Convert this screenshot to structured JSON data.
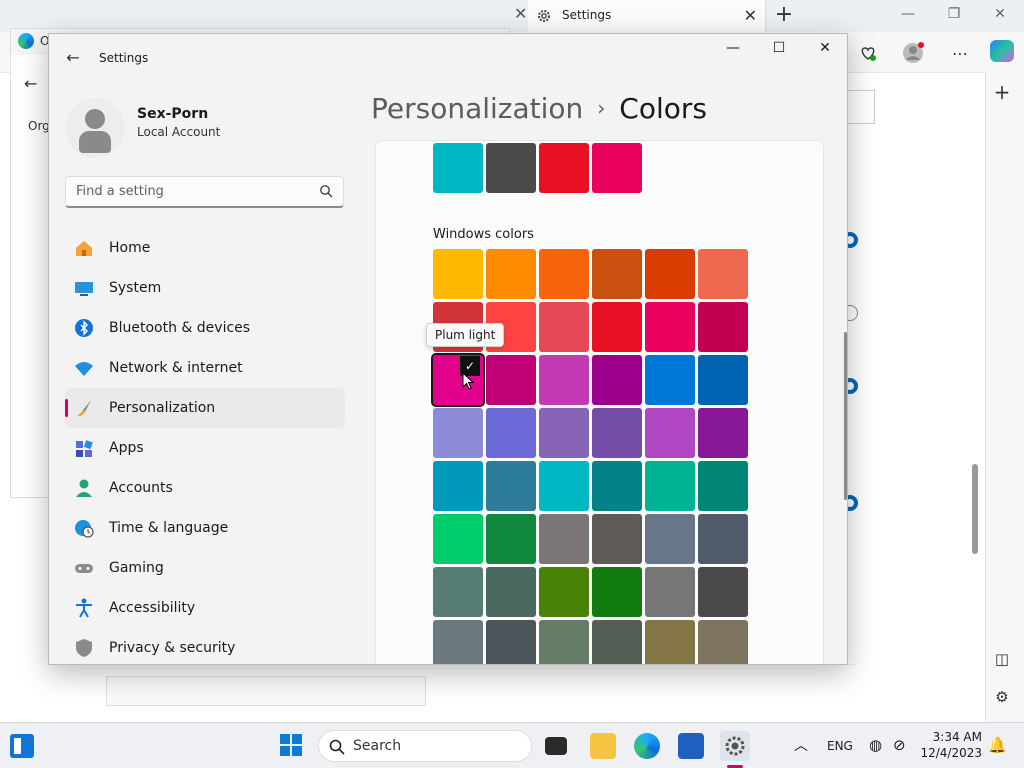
{
  "browser": {
    "tab_title": "Settings",
    "tab_close": "✕",
    "new_tab": "+",
    "inner_partial_tab": "O",
    "inner_close": "✕",
    "org_partial": "Org",
    "win_minimize": "—",
    "win_maximize": "❐",
    "win_close": "✕"
  },
  "settings_window": {
    "app_title": "Settings",
    "minimize": "—",
    "maximize": "☐",
    "close": "✕",
    "user": {
      "name": "Sex-Porn",
      "account_type": "Local Account"
    },
    "search": {
      "placeholder": "Find a setting"
    },
    "nav": [
      {
        "id": "home",
        "label": "Home",
        "icon": "home-icon"
      },
      {
        "id": "system",
        "label": "System",
        "icon": "monitor-icon"
      },
      {
        "id": "bluetooth",
        "label": "Bluetooth & devices",
        "icon": "bluetooth-icon"
      },
      {
        "id": "network",
        "label": "Network & internet",
        "icon": "wifi-icon"
      },
      {
        "id": "personalization",
        "label": "Personalization",
        "icon": "brush-icon",
        "active": true
      },
      {
        "id": "apps",
        "label": "Apps",
        "icon": "apps-icon"
      },
      {
        "id": "accounts",
        "label": "Accounts",
        "icon": "person-icon"
      },
      {
        "id": "time",
        "label": "Time & language",
        "icon": "globe-clock-icon"
      },
      {
        "id": "gaming",
        "label": "Gaming",
        "icon": "gamepad-icon"
      },
      {
        "id": "accessibility",
        "label": "Accessibility",
        "icon": "accessibility-icon"
      },
      {
        "id": "privacy",
        "label": "Privacy & security",
        "icon": "shield-icon"
      }
    ],
    "breadcrumb": {
      "parent": "Personalization",
      "separator": "›",
      "current": "Colors"
    },
    "recent_colors": [
      "#00b7c3",
      "#4c4a48",
      "#e81123",
      "#ea005e"
    ],
    "windows_colors_label": "Windows colors",
    "windows_colors": [
      [
        "#ffb900",
        "#ff8c00",
        "#f7630c",
        "#ca5010",
        "#da3b01",
        "#ef6950"
      ],
      [
        "#d13438",
        "#ff4343",
        "#e74856",
        "#e81123",
        "#ea005e",
        "#c30052"
      ],
      [
        "#e3008c",
        "#bf0077",
        "#c239b3",
        "#9a0089",
        "#0078d7",
        "#0063b1"
      ],
      [
        "#8e8cd8",
        "#6b69d6",
        "#8764b8",
        "#744da9",
        "#b146c2",
        "#881798"
      ],
      [
        "#0099bc",
        "#2d7d9a",
        "#00b7c3",
        "#038387",
        "#00b294",
        "#018574"
      ],
      [
        "#00cc6a",
        "#10893e",
        "#7a7574",
        "#5d5a58",
        "#68768a",
        "#515c6b"
      ],
      [
        "#567c73",
        "#486860",
        "#498205",
        "#107c10",
        "#767676",
        "#4c4a48"
      ],
      [
        "#69797e",
        "#4a5459",
        "#647c64",
        "#525e54",
        "#847545",
        "#7e735f"
      ]
    ],
    "selected_color": {
      "row": 2,
      "col": 0,
      "tooltip": "Plum light"
    },
    "check_mark": "✓"
  },
  "taskbar": {
    "search_label": "Search",
    "language": "ENG",
    "time": "3:34 AM",
    "date": "12/4/2023"
  },
  "colors": {
    "accent": "#d0006f",
    "windows_blue": "#0a7cd8"
  }
}
